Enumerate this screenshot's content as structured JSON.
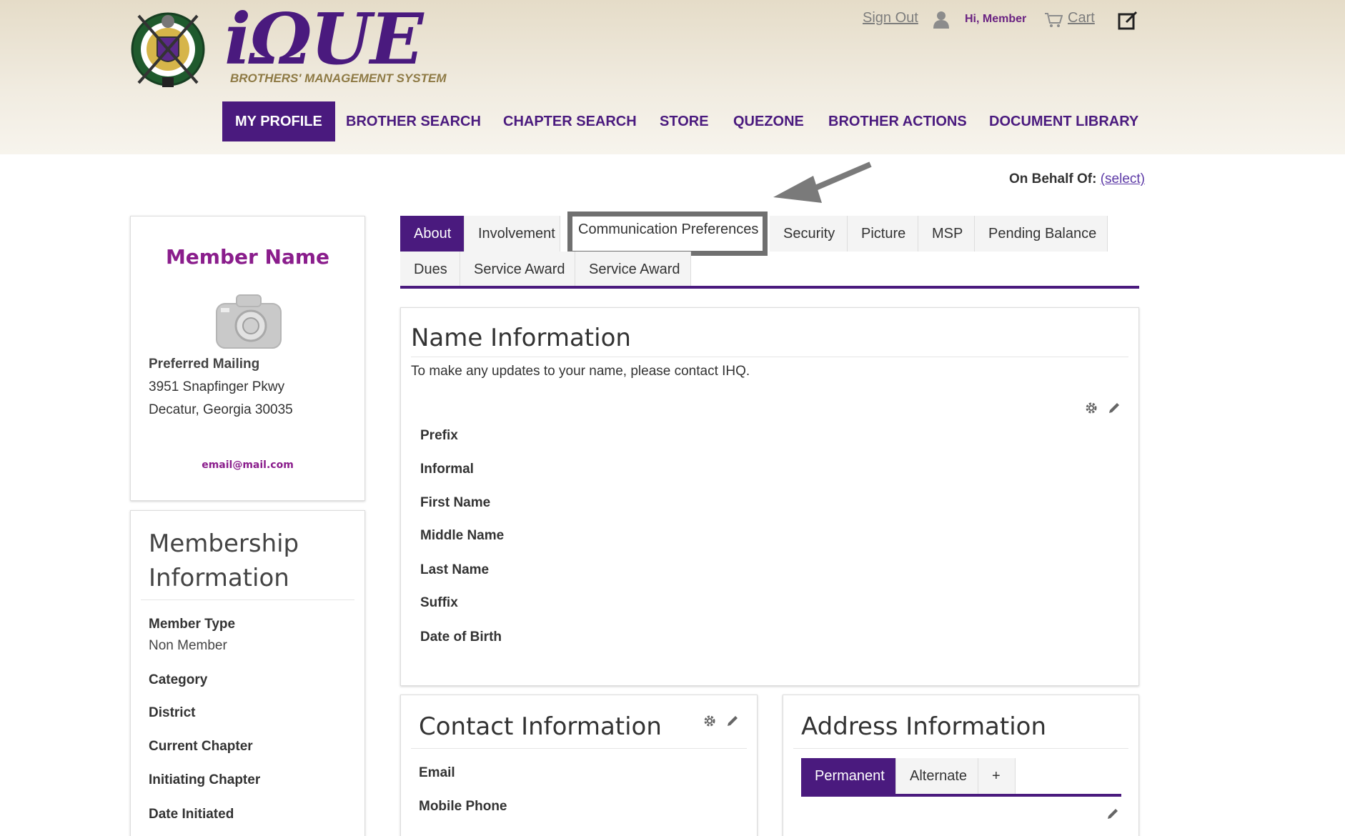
{
  "brand": {
    "title": "iΩUE",
    "subtitle": "BROTHERS' MANAGEMENT SYSTEM"
  },
  "top_links": {
    "sign_out": "Sign Out",
    "greeting": "Hi, Member",
    "cart": "Cart"
  },
  "nav": [
    "MY PROFILE",
    "BROTHER SEARCH",
    "CHAPTER SEARCH",
    "STORE",
    "QUEZONE",
    "BROTHER ACTIONS",
    "DOCUMENT LIBRARY"
  ],
  "behalf": {
    "label": "On Behalf Of:",
    "link": "(select)"
  },
  "member_card": {
    "name": "Member Name",
    "mailing_label": "Preferred Mailing",
    "address_line1": "3951 Snapfinger Pkwy",
    "address_line2": "Decatur, Georgia 30035",
    "email": "email@mail.com"
  },
  "membership": {
    "title": "Membership Information",
    "member_type_label": "Member Type",
    "member_type_value": "Non Member",
    "fields": [
      "Category",
      "District",
      "Current Chapter",
      "Initiating Chapter",
      "Date Initiated"
    ]
  },
  "tabs": {
    "row1": [
      "About",
      "Involvement",
      "Communication Preferences",
      "Security",
      "Picture",
      "MSP",
      "Pending Balance"
    ],
    "row2": [
      "Dues",
      "Service Award",
      "Service Award"
    ]
  },
  "name_info": {
    "title": "Name Information",
    "note": "To make any updates to your name, please contact IHQ.",
    "fields": [
      "Prefix",
      "Informal",
      "First Name",
      "Middle Name",
      "Last Name",
      "Suffix",
      "Date of Birth"
    ]
  },
  "contact_info": {
    "title": "Contact Information",
    "fields": [
      "Email",
      "Mobile Phone"
    ]
  },
  "address_info": {
    "title": "Address Information",
    "tabs": [
      "Permanent",
      "Alternate",
      "+"
    ]
  },
  "colors": {
    "brand_purple": "#4a1a7e",
    "accent_magenta": "#8a1d8c",
    "header_bg": "#ece4d3"
  },
  "icons": [
    "crest-logo",
    "person-icon",
    "cart-icon",
    "edit-note-icon",
    "camera-icon",
    "gear-icon",
    "pencil-icon",
    "arrow-icon"
  ]
}
